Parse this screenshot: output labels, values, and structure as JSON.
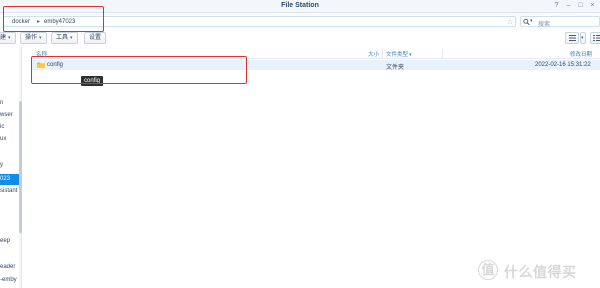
{
  "window": {
    "title": "File Station",
    "controls": [
      "?",
      "–",
      "□",
      "×"
    ]
  },
  "pathbar": {
    "crumbs": [
      "docker",
      "emby47023"
    ],
    "search_placeholder": "搜索"
  },
  "toolbar": {
    "create_label": "建",
    "actions_label": "操作",
    "tools_label": "工具",
    "settings_label": "设置"
  },
  "sidebar": {
    "items": [
      {
        "label": "n"
      },
      {
        "label": "wser"
      },
      {
        "label": "ic"
      },
      {
        "label": "ux"
      },
      {
        "label": "y"
      },
      {
        "label": "023",
        "active": true
      },
      {
        "label": "sistant"
      },
      {
        "label": "eep"
      },
      {
        "label": "eader"
      },
      {
        "label": "-emby"
      }
    ]
  },
  "list": {
    "columns": {
      "name": "名称",
      "size": "大小",
      "type": "文件类型",
      "modified": "修改日期"
    },
    "rows": [
      {
        "name": "config",
        "size": "",
        "type": "文件夹",
        "modified": "2022-02-16 15:31:22"
      }
    ],
    "tooltip": "config"
  },
  "watermark": {
    "logo": "值",
    "text": "什么值得买"
  },
  "colors": {
    "accent": "#0c8ee9",
    "selection": "#e6f2fc",
    "annotation": "#e0302a"
  }
}
